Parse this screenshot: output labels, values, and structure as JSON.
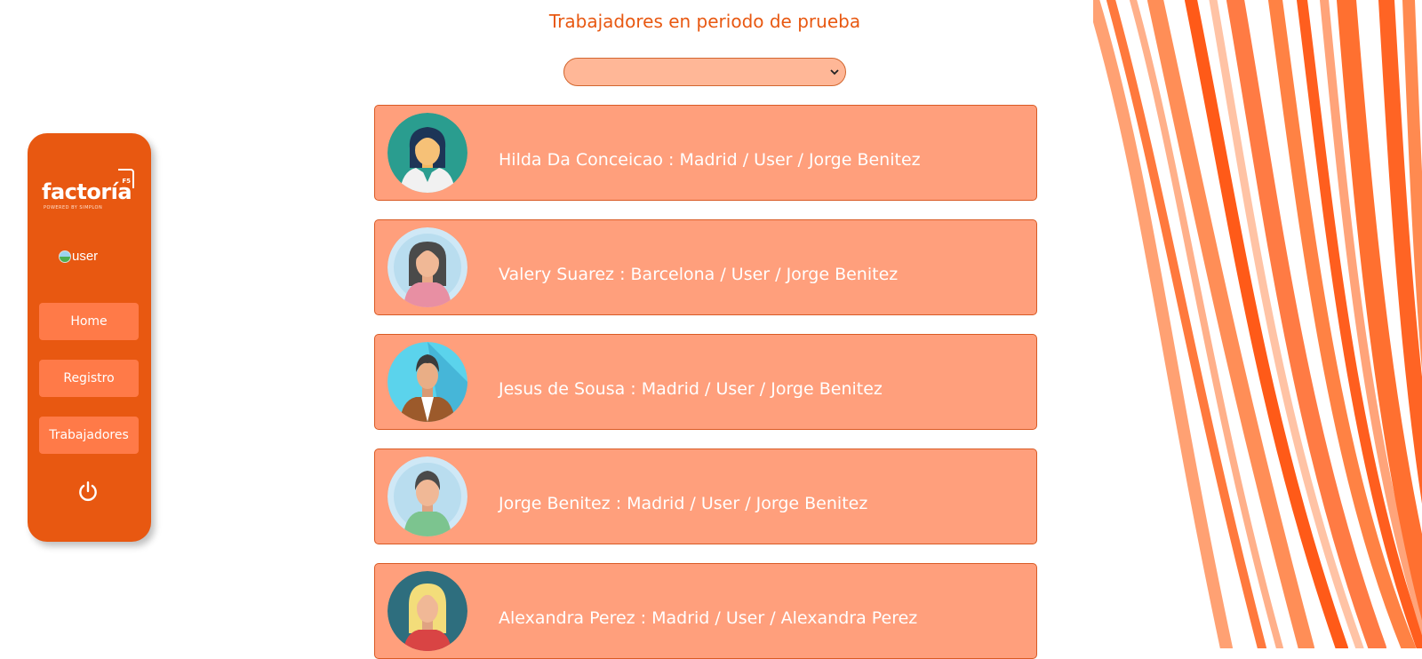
{
  "page_title": "Trabajadores en periodo de prueba",
  "filter_select": {
    "selected": ""
  },
  "sidebar": {
    "logo": {
      "name": "factoría",
      "tag": "POWERED BY SIMPLON",
      "mark": "F5"
    },
    "user_image_alt": "user",
    "nav": [
      {
        "label": "Home"
      },
      {
        "label": "Registro"
      },
      {
        "label": "Trabajadores"
      }
    ],
    "logout_icon": "power-icon"
  },
  "workers": [
    {
      "text": "Hilda Da Conceicao : Madrid / User / Jorge Benitez",
      "avatar": "woman-doctor-avatar"
    },
    {
      "text": "Valery Suarez : Barcelona / User / Jorge Benitez",
      "avatar": "woman-dark-hair-avatar"
    },
    {
      "text": "Jesus de Sousa : Madrid / User / Jorge Benitez",
      "avatar": "man-jacket-avatar"
    },
    {
      "text": "Jorge Benitez : Madrid / User / Jorge Benitez",
      "avatar": "man-green-shirt-avatar"
    },
    {
      "text": "Alexandra Perez : Madrid / User / Alexandra Perez",
      "avatar": "woman-blonde-avatar"
    }
  ],
  "colors": {
    "accent": "#e85811",
    "card_bg": "#ff9f7c",
    "button_bg": "#ff7a48",
    "select_bg": "#ffb797"
  }
}
